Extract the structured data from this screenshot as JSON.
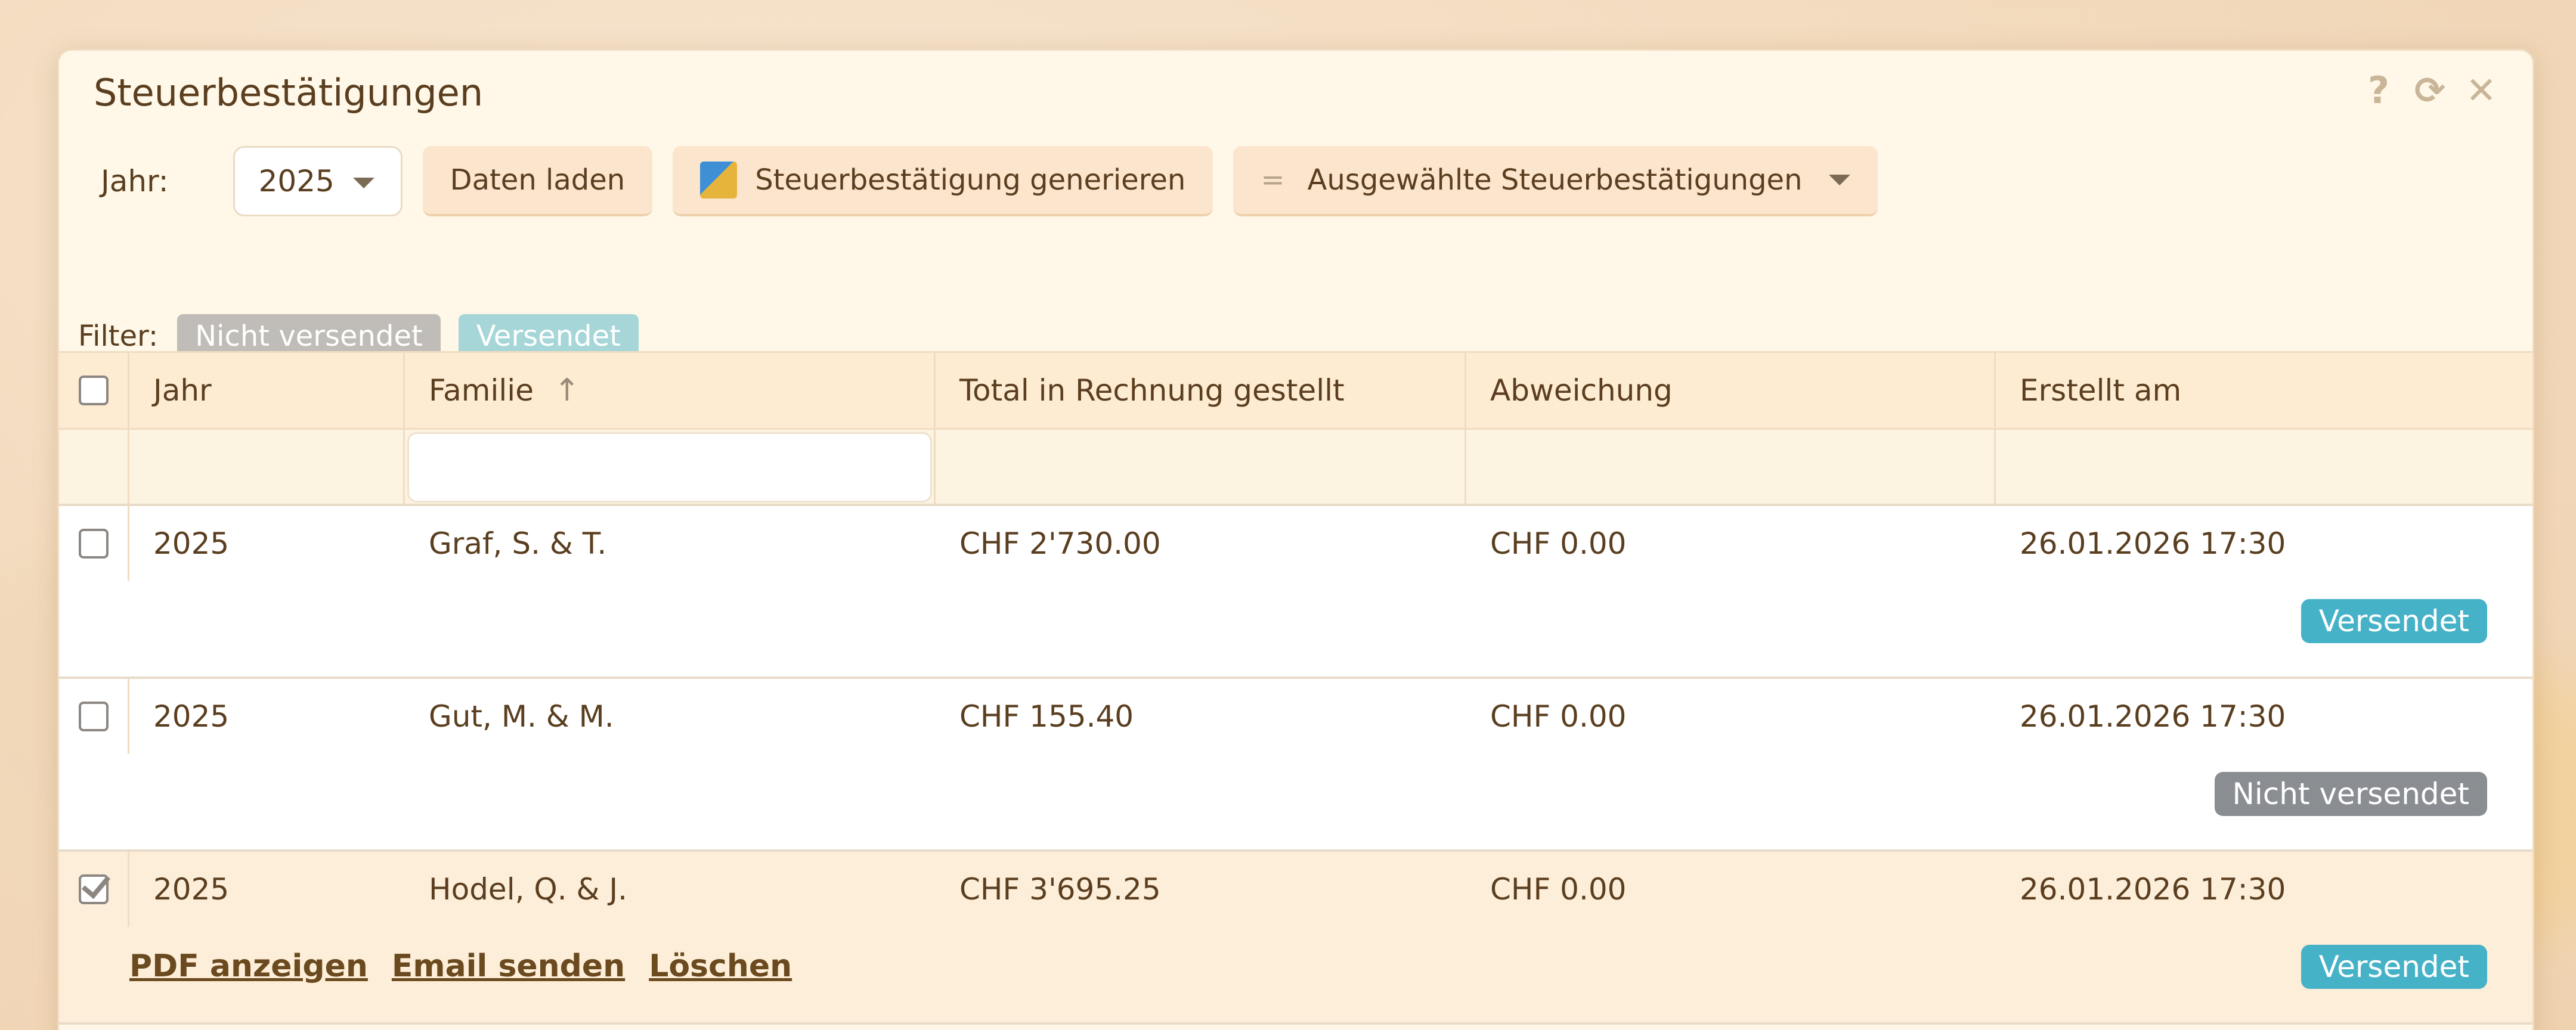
{
  "window": {
    "title": "Steuerbestätigungen"
  },
  "toolbar": {
    "year_label": "Jahr:",
    "year_value": "2025",
    "load_button": "Daten laden",
    "generate_button": "Steuerbestätigung generieren",
    "selected_menu": "Ausgewählte Steuerbestätigungen",
    "selected_menu_prefix": "="
  },
  "filter": {
    "label": "Filter:",
    "chips": [
      "Nicht versendet",
      "Versendet"
    ]
  },
  "table": {
    "columns": [
      "Jahr",
      "Familie",
      "Total in Rechnung gestellt",
      "Abweichung",
      "Erstellt am"
    ],
    "sort_indicator": "↑",
    "rows": [
      {
        "year": "2025",
        "family": "Graf, S. & T.",
        "total": "CHF 2'730.00",
        "deviation": "CHF 0.00",
        "created": "26.01.2026 17:30",
        "status": "Versendet"
      },
      {
        "year": "2025",
        "family": "Gut, M. & M.",
        "total": "CHF 155.40",
        "deviation": "CHF 0.00",
        "created": "26.01.2026 17:30",
        "status": "Nicht versendet"
      },
      {
        "year": "2025",
        "family": "Hodel, Q. & J.",
        "total": "CHF 3'695.25",
        "deviation": "CHF 0.00",
        "created": "26.01.2026 17:30",
        "status": "Versendet"
      }
    ],
    "row_actions": [
      "PDF anzeigen",
      "Email senden",
      "Löschen"
    ]
  },
  "icons": {
    "help": "?",
    "refresh": "⟳",
    "close": "✕"
  },
  "colors": {
    "badge_sent": "#46b2c8",
    "badge_not_sent": "#8a8e93",
    "selected_row": "#fdeed9"
  }
}
